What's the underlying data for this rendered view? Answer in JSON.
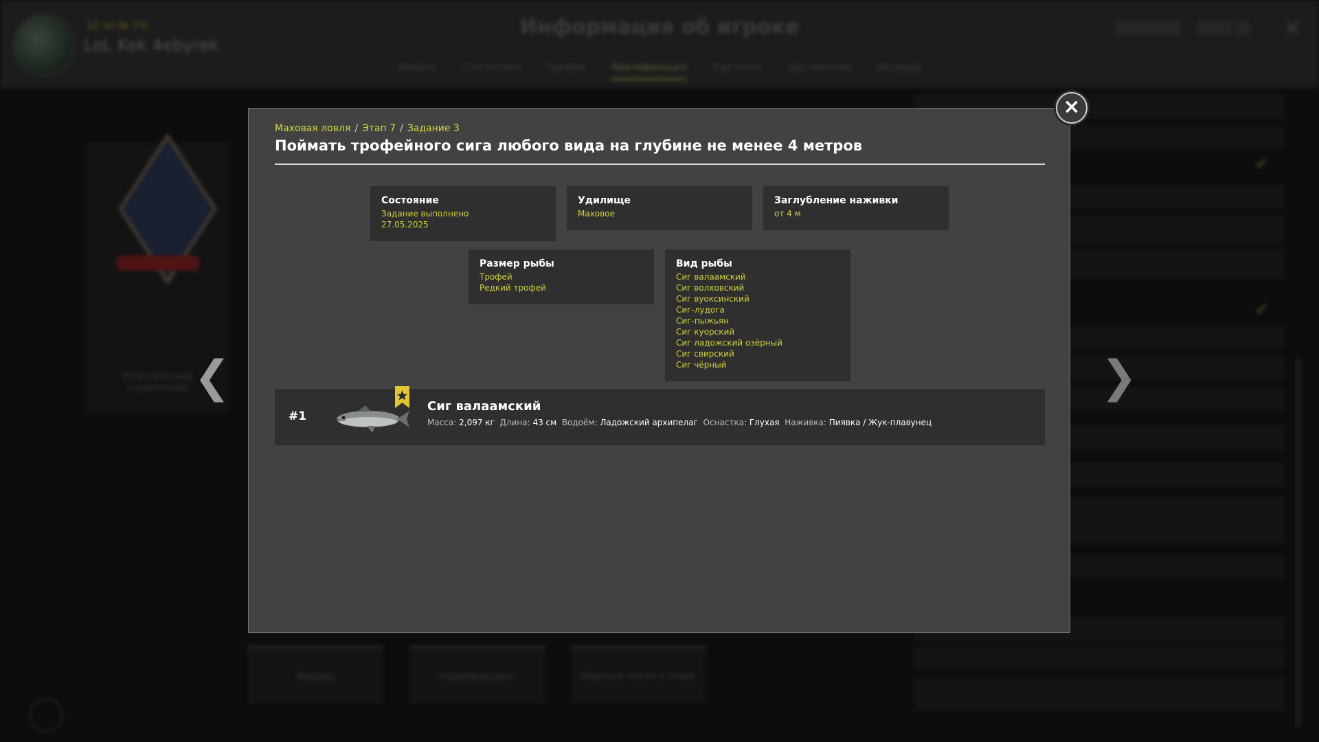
{
  "background": {
    "player": {
      "level_text": "12 lvl  №  7%",
      "name": "LoL Kek 4ebyrek"
    },
    "title": "Информация об игроке",
    "tabs": [
      "Навыки",
      "Статистика",
      "Трофеи",
      "Квалификация",
      "Карточки",
      "Достижения",
      "Награды"
    ],
    "active_tab": "Квалификация",
    "bottom_buttons": [
      "Фидер",
      "Карпфишинг",
      "Морская ловля в отвес"
    ],
    "left_card_caption": "Классическое снаряжение"
  },
  "modal": {
    "breadcrumb": [
      "Маховая ловля",
      "Этап 7",
      "Задание 3"
    ],
    "breadcrumb_separator": "/",
    "title": "Поймать трофейного сига любого вида на глубине не менее 4 метров",
    "close_icon": "×",
    "cards": [
      {
        "title": "Состояние",
        "lines": [
          "Задание выполнено",
          "27.05.2025"
        ]
      },
      {
        "title": "Удилище",
        "lines": [
          "Маховое"
        ]
      },
      {
        "title": "Заглубление наживки",
        "lines": [
          "от 4 м"
        ]
      },
      {
        "title": "Размер рыбы",
        "lines": [
          "Трофей",
          "Редкий трофей"
        ]
      },
      {
        "title": "Вид рыбы",
        "lines": [
          "Сиг валаамский",
          "Сиг волховский",
          "Сиг вуоксинский",
          "Сиг-лудога",
          "Сиг-пыжьян",
          "Сиг куорский",
          "Сиг ладожский озёрный",
          "Сиг свирский",
          "Сиг чёрный"
        ]
      }
    ],
    "catch": {
      "rank": "#1",
      "fish_name": "Сиг валаамский",
      "mass_label": "Масса:",
      "mass": "2,097 кг",
      "length_label": "Длина:",
      "length": "43 см",
      "water_label": "Водоём:",
      "water": "Ладожский архипелаг",
      "rig_label": "Оснастка:",
      "rig": "Глухая",
      "bait_label": "Наживка:",
      "bait": "Пиявка / Жук-плавунец"
    }
  },
  "colors": {
    "accent_yellow": "#d7d83b",
    "modal_bg": "#424242",
    "card_bg": "#2f2f2f"
  }
}
